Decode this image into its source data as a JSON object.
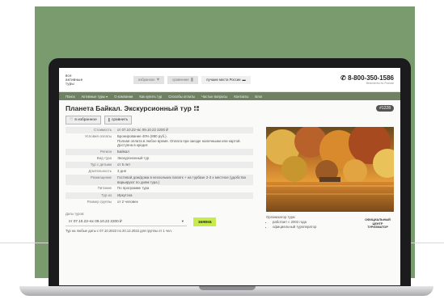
{
  "header": {
    "logo_lines": [
      "все",
      "активные",
      "туры"
    ],
    "favorites_label": "избранное",
    "compare_label": "сравнение",
    "best_places_label": "лучшие места России",
    "phone": "8-800-350-1586",
    "phone_sub": "бесплатно по России"
  },
  "nav": {
    "items": [
      "Поиск",
      "Активные туры ▾",
      "О компании",
      "Как купить тур",
      "Способы оплаты",
      "Частые вопросы",
      "Контакты",
      "Блог"
    ]
  },
  "tour": {
    "title": "Планета Байкал. Экскурсионный тур",
    "id_badge": "#1228",
    "favorite_btn": "в избранное",
    "compare_btn": "сравнить"
  },
  "specs": [
    {
      "key": "Стоимость",
      "value": "от 07.10.22–вс 09.10.22  2200 ₽"
    },
    {
      "key": "Условия оплаты",
      "value": "Бронирование 40% (880 руб.).\nПолная оплата в любое время. Оплата при заезде наличными или картой.\nДоступна в кредит."
    },
    {
      "key": "Регион",
      "value": "Байкал"
    },
    {
      "key": "Вид тура",
      "value": "Экскурсионный тур"
    },
    {
      "key": "Тур с детьми",
      "value": "от 5 лет"
    },
    {
      "key": "Длительность",
      "value": "3 дня"
    },
    {
      "key": "Размещение",
      "value": "Гостевой дом/дома в нескольких палатк + на турбазе 2-3 х местное (удобства варьируют по дням тура )"
    },
    {
      "key": "Питание",
      "value": "По программе тура"
    },
    {
      "key": "Тур из",
      "value": "Иркутска"
    },
    {
      "key": "Размер группы",
      "value": "от 2 человек"
    }
  ],
  "booking": {
    "dates_label": "Даты туров:",
    "selected_date": "пт 07.10.22–вс 09.10.22   2200 ₽",
    "order_btn": "заявка",
    "note": "Тур на любые даты с 07.10.2022 по 20.12.2022 для группы от 1 чел."
  },
  "organizer": {
    "title": "Организатор тура:",
    "bullets": [
      "работает с 2002 года",
      "официальный туроператор"
    ],
    "logo_lines": [
      "ОФИЦИАЛЬНЫЙ",
      "ЦЕНТР",
      "ТУРИЗМАТОР"
    ]
  },
  "colors": {
    "background_green": "#7a9b6e",
    "nav_green": "#6f8063",
    "order_button": "#c7eb4f"
  }
}
